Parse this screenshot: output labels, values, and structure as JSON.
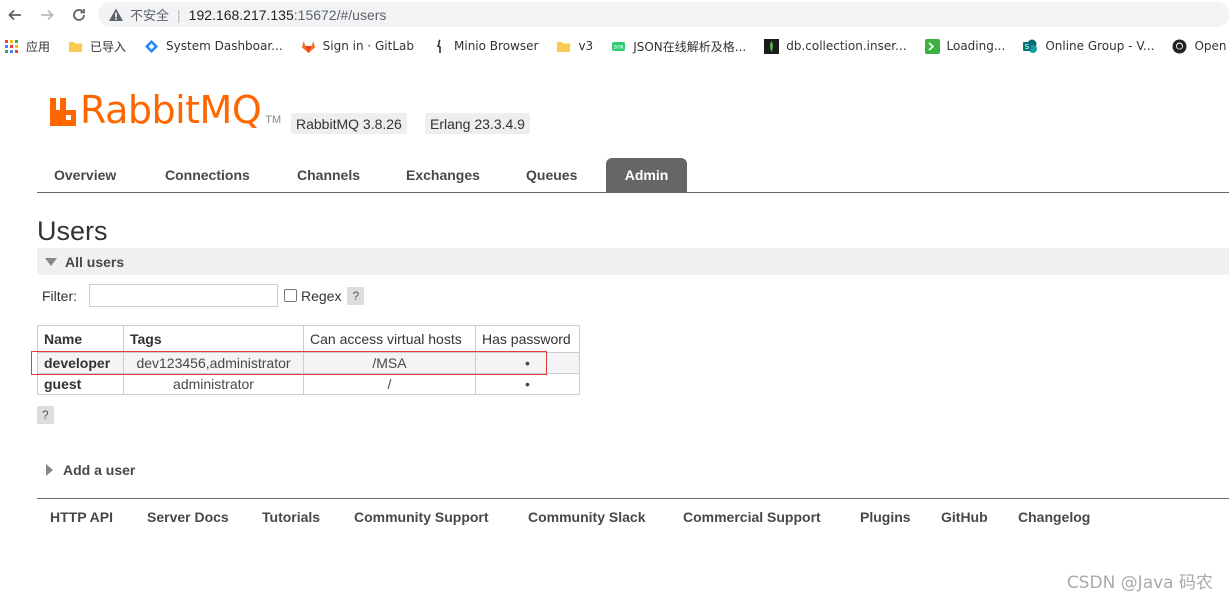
{
  "browser": {
    "insecure_label": "不安全",
    "url_host": "192.168.217.135",
    "url_rest": ":15672/#/users",
    "bookmarks": [
      {
        "label": "应用",
        "icon": "apps-grid-icon"
      },
      {
        "label": "已导入",
        "icon": "folder-icon"
      },
      {
        "label": "System Dashboar...",
        "icon": "diamond-icon"
      },
      {
        "label": "Sign in · GitLab",
        "icon": "gitlab-icon"
      },
      {
        "label": "Minio Browser",
        "icon": "minio-icon"
      },
      {
        "label": "v3",
        "icon": "folder-icon"
      },
      {
        "label": "JSON在线解析及格...",
        "icon": "json-icon"
      },
      {
        "label": "db.collection.inser...",
        "icon": "mongodb-icon"
      },
      {
        "label": "Loading...",
        "icon": "terminal-icon"
      },
      {
        "label": "Online Group - V...",
        "icon": "sharepoint-icon"
      },
      {
        "label": "Open Zipk",
        "icon": "github-icon"
      }
    ]
  },
  "header": {
    "logo_text": "RabbitMQ",
    "logo_tm": "TM",
    "rabbitmq_version": "RabbitMQ 3.8.26",
    "erlang_version": "Erlang 23.3.4.9"
  },
  "tabs": [
    {
      "label": "Overview"
    },
    {
      "label": "Connections"
    },
    {
      "label": "Channels"
    },
    {
      "label": "Exchanges"
    },
    {
      "label": "Queues"
    },
    {
      "label": "Admin"
    }
  ],
  "page": {
    "title": "Users",
    "section_all_users": "All users",
    "filter_label": "Filter:",
    "filter_value": "",
    "regex_label": "Regex",
    "help_label": "?",
    "add_user_label": "Add a user"
  },
  "users_table": {
    "headers": [
      "Name",
      "Tags",
      "Can access virtual hosts",
      "Has password"
    ],
    "rows": [
      {
        "name": "developer",
        "tags": "dev123456,administrator",
        "vhosts": "/MSA",
        "has_password": "•"
      },
      {
        "name": "guest",
        "tags": "administrator",
        "vhosts": "/",
        "has_password": "•"
      }
    ]
  },
  "footer": {
    "links": [
      "HTTP API",
      "Server Docs",
      "Tutorials",
      "Community Support",
      "Community Slack",
      "Commercial Support",
      "Plugins",
      "GitHub",
      "Changelog"
    ]
  },
  "watermark": "CSDN @Java 码农",
  "colors": {
    "brand_orange": "#ff6600",
    "highlight_red": "#e23b3b",
    "tab_active": "#666666"
  }
}
